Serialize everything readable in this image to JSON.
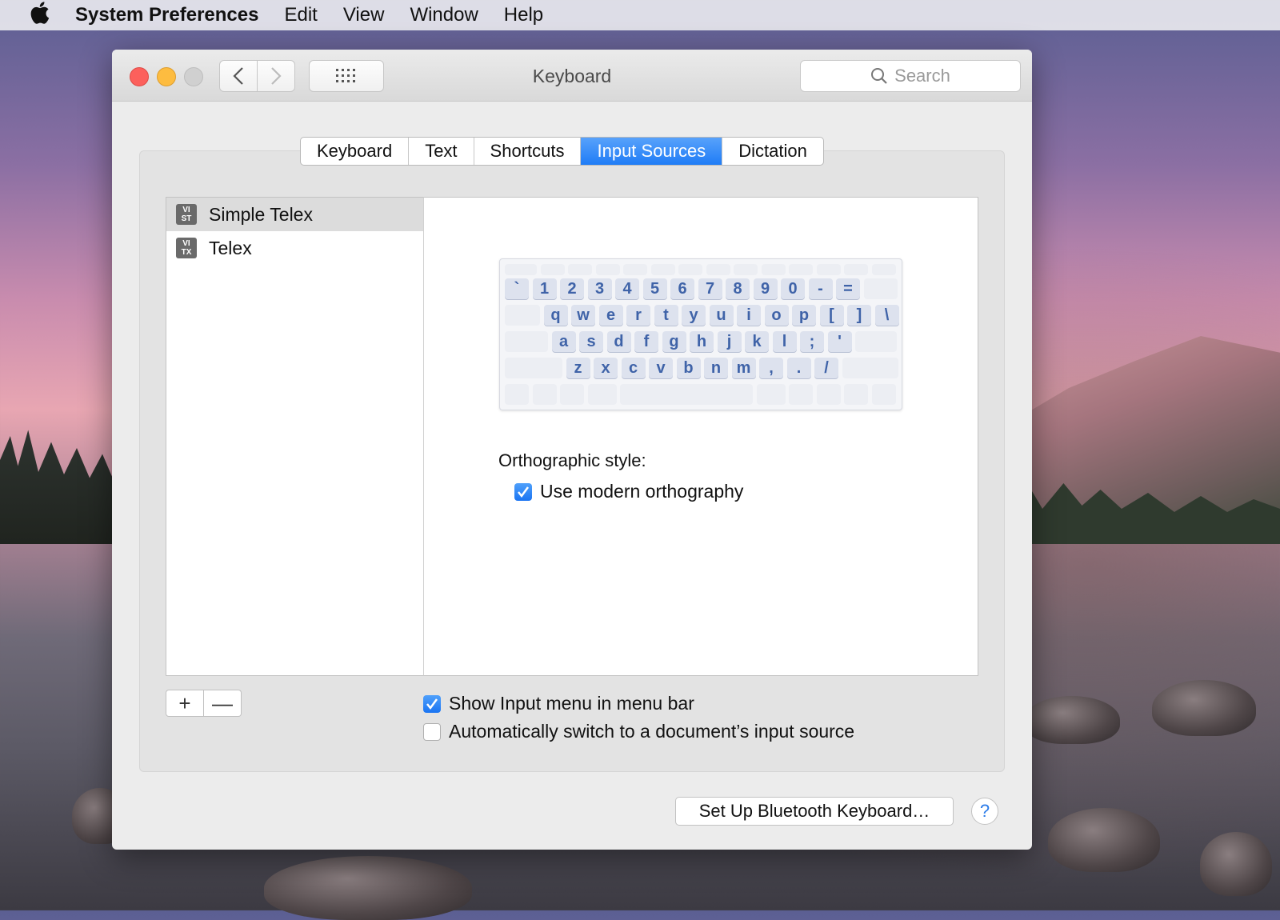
{
  "menubar": {
    "app_name": "System Preferences",
    "items": [
      "Edit",
      "View",
      "Window",
      "Help"
    ]
  },
  "window": {
    "title": "Keyboard",
    "search_placeholder": "Search"
  },
  "tabs": [
    {
      "label": "Keyboard",
      "active": false
    },
    {
      "label": "Text",
      "active": false
    },
    {
      "label": "Shortcuts",
      "active": false
    },
    {
      "label": "Input Sources",
      "active": true
    },
    {
      "label": "Dictation",
      "active": false
    }
  ],
  "sources": [
    {
      "badge_top": "VI",
      "badge_bottom": "ST",
      "label": "Simple Telex",
      "selected": true
    },
    {
      "badge_top": "VI",
      "badge_bottom": "TX",
      "label": "Telex",
      "selected": false
    }
  ],
  "keyboard": {
    "row1": [
      "`",
      "1",
      "2",
      "3",
      "4",
      "5",
      "6",
      "7",
      "8",
      "9",
      "0",
      "-",
      "="
    ],
    "row2": [
      "q",
      "w",
      "e",
      "r",
      "t",
      "y",
      "u",
      "i",
      "o",
      "p",
      "[",
      "]",
      "\\"
    ],
    "row3": [
      "a",
      "s",
      "d",
      "f",
      "g",
      "h",
      "j",
      "k",
      "l",
      ";",
      "'"
    ],
    "row4": [
      "z",
      "x",
      "c",
      "v",
      "b",
      "n",
      "m",
      ",",
      ".",
      "/"
    ]
  },
  "ortho": {
    "label": "Orthographic style:",
    "checkbox_label": "Use modern orthography",
    "checked": true
  },
  "options": {
    "show_input_menu": "Show Input menu in menu bar",
    "show_input_menu_checked": true,
    "auto_switch": "Automatically switch to a document’s input source",
    "auto_switch_checked": false
  },
  "buttons": {
    "plus": "+",
    "minus": "—",
    "bluetooth": "Set Up Bluetooth Keyboard…",
    "help": "?"
  },
  "colors": {
    "accent": "#1f7cf6",
    "close": "#fc605c",
    "minimize": "#fdbc40"
  }
}
